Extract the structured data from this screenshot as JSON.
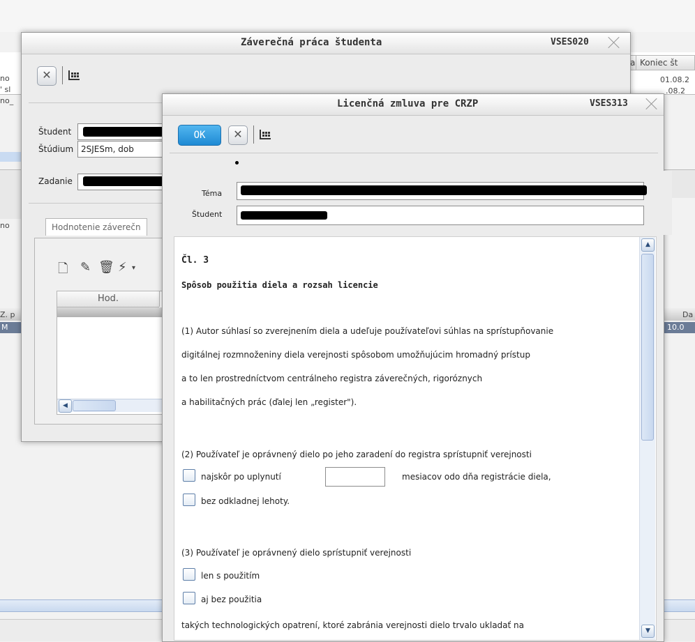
{
  "background": {
    "col_right_1": "a",
    "col_right_2": "Koniec št",
    "date_1": "01.08.2",
    "date_2": ".08.2",
    "left_frag_1": "no",
    "left_frag_2": "' sl",
    "left_frag_3": "no_",
    "left_frag_4": "no",
    "left_frag_5": "Z. p",
    "left_frag_6": "M",
    "right_frag_1": "Da",
    "right_frag_2": "10.0"
  },
  "dialog_outer": {
    "title": "Záverečná práca študenta",
    "code": "VSES020",
    "fields": [
      {
        "label": "Študent",
        "value": ""
      },
      {
        "label": "Štúdium",
        "value": "2SJESm, dob"
      },
      {
        "label": "Zadanie",
        "value": ""
      }
    ],
    "tab_label": "Hodnotenie záverečn",
    "table_header": "Hod."
  },
  "dialog_inner": {
    "title": "Licenčná zmluva pre CRZP",
    "code": "VSES313",
    "ok_label": "OK",
    "fields": [
      {
        "label": "Téma",
        "value": ""
      },
      {
        "label": "Študent",
        "value": ""
      }
    ],
    "article_title": "Čl. 3",
    "article_subtitle": "Spôsob použitia diela a rozsah licencie",
    "para1": [
      "(1) Autor súhlasí so zverejnením diela a udeľuje používateľovi súhlas na sprístupňovanie",
      "digitálnej rozmnoženiny diela verejnosti spôsobom umožňujúcim hromadný prístup",
      "a to len prostredníctvom centrálneho registra záverečných, rigoróznych",
      "a habilitačných prác (ďalej len „register\")."
    ],
    "para2": "(2) Používateľ je oprávnený dielo po jeho zaradení do registra sprístupniť verejnosti",
    "opt_after": "najskôr po uplynutí",
    "opt_after_suffix": "mesiacov odo dňa registrácie diela,",
    "months_value": "",
    "opt_immediate": "bez odkladnej lehoty.",
    "para3": "(3) Používateľ je oprávnený dielo sprístupniť verejnosti",
    "opt_only_with": "len s použitím",
    "opt_without": "aj bez použitia",
    "para3_tail": "takých technologických opatrení, ktoré zabránia verejnosti dielo trvalo ukladať na"
  }
}
